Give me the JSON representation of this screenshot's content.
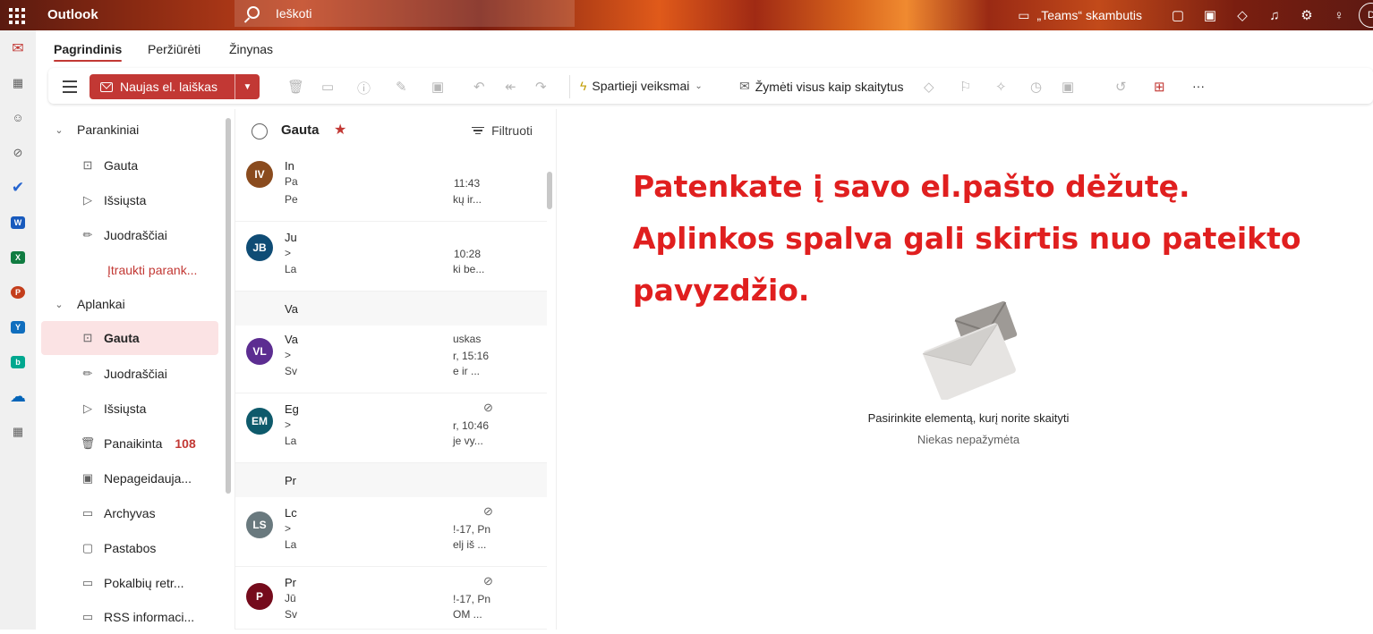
{
  "app": {
    "brand": "Outlook"
  },
  "search": {
    "placeholder": "Ieškoti"
  },
  "topbar": {
    "teams_call": "„Teams“ skambutis",
    "avatar_initial": "D"
  },
  "tabs": [
    "Pagrindinis",
    "Peržiūrėti",
    "Žinynas"
  ],
  "ribbon": {
    "new_mail": "Naujas el. laiškas",
    "quick_steps": "Spartieji veiksmai",
    "mark_all_read": "Žymėti visus kaip skaitytus",
    "more": "···"
  },
  "folders": {
    "favorites_header": "Parankiniai",
    "favorites": [
      {
        "label": "Gauta",
        "icon": "inbox-icon"
      },
      {
        "label": "Išsiųsta",
        "icon": "send-icon"
      },
      {
        "label": "Juodraščiai",
        "icon": "draft-icon"
      }
    ],
    "add_favorite": "Įtraukti parank...",
    "folders_header": "Aplankai",
    "items": [
      {
        "label": "Gauta",
        "icon": "inbox-icon",
        "selected": true
      },
      {
        "label": "Juodraščiai",
        "icon": "draft-icon"
      },
      {
        "label": "Išsiųsta",
        "icon": "send-icon"
      },
      {
        "label": "Panaikinta",
        "icon": "trash-icon",
        "count": "108"
      },
      {
        "label": "Nepageidauja...",
        "icon": "junk-icon"
      },
      {
        "label": "Archyvas",
        "icon": "archive-icon"
      },
      {
        "label": "Pastabos",
        "icon": "note-icon"
      },
      {
        "label": "Pokalbių retr...",
        "icon": "folder-icon"
      },
      {
        "label": "RSS informaci...",
        "icon": "folder-icon"
      }
    ]
  },
  "list": {
    "title": "Gauta",
    "filter": "Filtruoti",
    "messages": [
      {
        "initials": "IV",
        "color": "#8a4b1e",
        "l1": "In",
        "l2": "Pa",
        "l3": "Pe",
        "r1": "",
        "r2": "11:43",
        "r3": "kų ir...",
        "attach": false
      },
      {
        "initials": "JB",
        "color": "#0f4c75",
        "l1": "Ju",
        "l2": ">",
        "l3": "La",
        "r1": "",
        "r2": "10:28",
        "r3": "ki be...",
        "attach": false
      },
      {
        "group": "Va"
      },
      {
        "initials": "VL",
        "color": "#5c2d91",
        "l1": "Va",
        "l2": ">",
        "l3": "Sv",
        "r1": "uskas",
        "r2": "r, 15:16",
        "r3": "e ir ...",
        "attach": false
      },
      {
        "initials": "EM",
        "color": "#0e5a6b",
        "l1": "Eg",
        "l2": ">",
        "l3": "La",
        "r1": "",
        "r2": "r, 10:46",
        "r3": "je vy...",
        "attach": true
      },
      {
        "group": "Pr"
      },
      {
        "initials": "LS",
        "color": "#69797e",
        "l1": "Lc",
        "l2": ">",
        "l3": "La",
        "r1": "",
        "r2": "!-17, Pn",
        "r3": "elj iš ...",
        "attach": true
      },
      {
        "initials": "P",
        "color": "#750b1c",
        "l1": "Pr",
        "l2": "Jū",
        "l3": "Sv",
        "r1": "",
        "r2": "!-17, Pn",
        "r3": "OM ...",
        "attach": true
      }
    ]
  },
  "reading": {
    "overlay_lines": [
      "Patenkate į savo el.pašto dėžutę.",
      "Aplinkos spalva gali skirtis nuo pateikto",
      "pavyzdžio."
    ],
    "empty_title": "Pasirinkite elementą, kurį norite skaityti",
    "empty_sub": "Niekas nepažymėta"
  },
  "colors": {
    "accent": "#c23834",
    "overlay_text": "#e01f1f"
  }
}
